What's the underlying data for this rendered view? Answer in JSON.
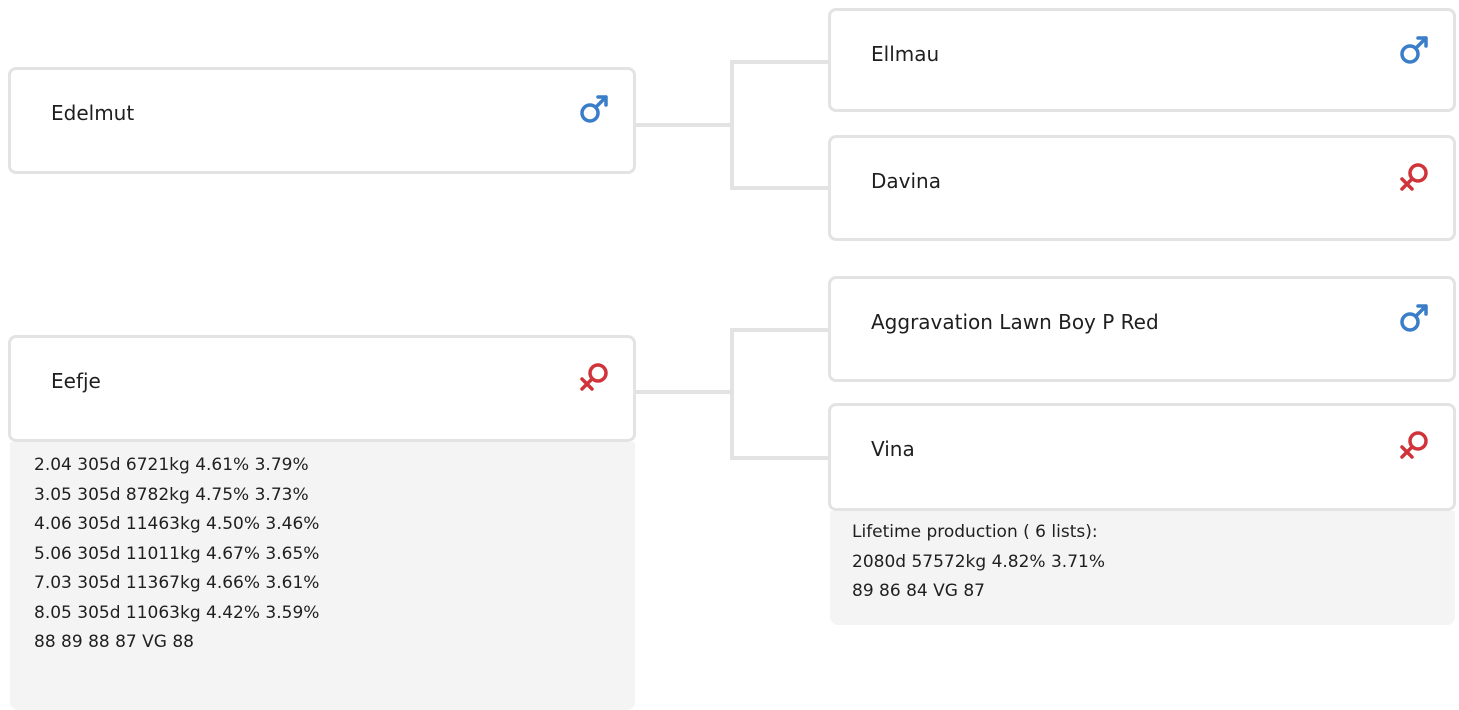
{
  "colors": {
    "male": "#3a7dc9",
    "female": "#d0343a",
    "connector": "#e3e3e3",
    "info_bg": "#f4f4f4"
  },
  "animals": {
    "self_sire": {
      "name": "Edelmut",
      "sex": "male",
      "icon": "male-symbol-icon"
    },
    "self_dam": {
      "name": "Eefje",
      "sex": "female",
      "icon": "female-symbol-icon"
    },
    "sire_sire": {
      "name": "Ellmau",
      "sex": "male",
      "icon": "male-symbol-icon"
    },
    "sire_dam": {
      "name": "Davina",
      "sex": "female",
      "icon": "female-symbol-icon"
    },
    "dam_sire": {
      "name": "Aggravation Lawn Boy P Red",
      "sex": "male",
      "icon": "male-symbol-icon"
    },
    "dam_dam": {
      "name": "Vina",
      "sex": "female",
      "icon": "female-symbol-icon"
    }
  },
  "eefje_production": [
    "2.04 305d 6721kg 4.61% 3.79%",
    "3.05 305d 8782kg 4.75% 3.73%",
    "4.06 305d 11463kg 4.50% 3.46%",
    "5.06 305d 11011kg 4.67% 3.65%",
    "7.03 305d 11367kg 4.66% 3.61%",
    "8.05 305d 11063kg 4.42% 3.59%",
    "88 89 88 87 VG 88"
  ],
  "vina_production": [
    "Lifetime production ( 6 lists):",
    "2080d 57572kg 4.82% 3.71%",
    "89 86 84 VG 87"
  ]
}
